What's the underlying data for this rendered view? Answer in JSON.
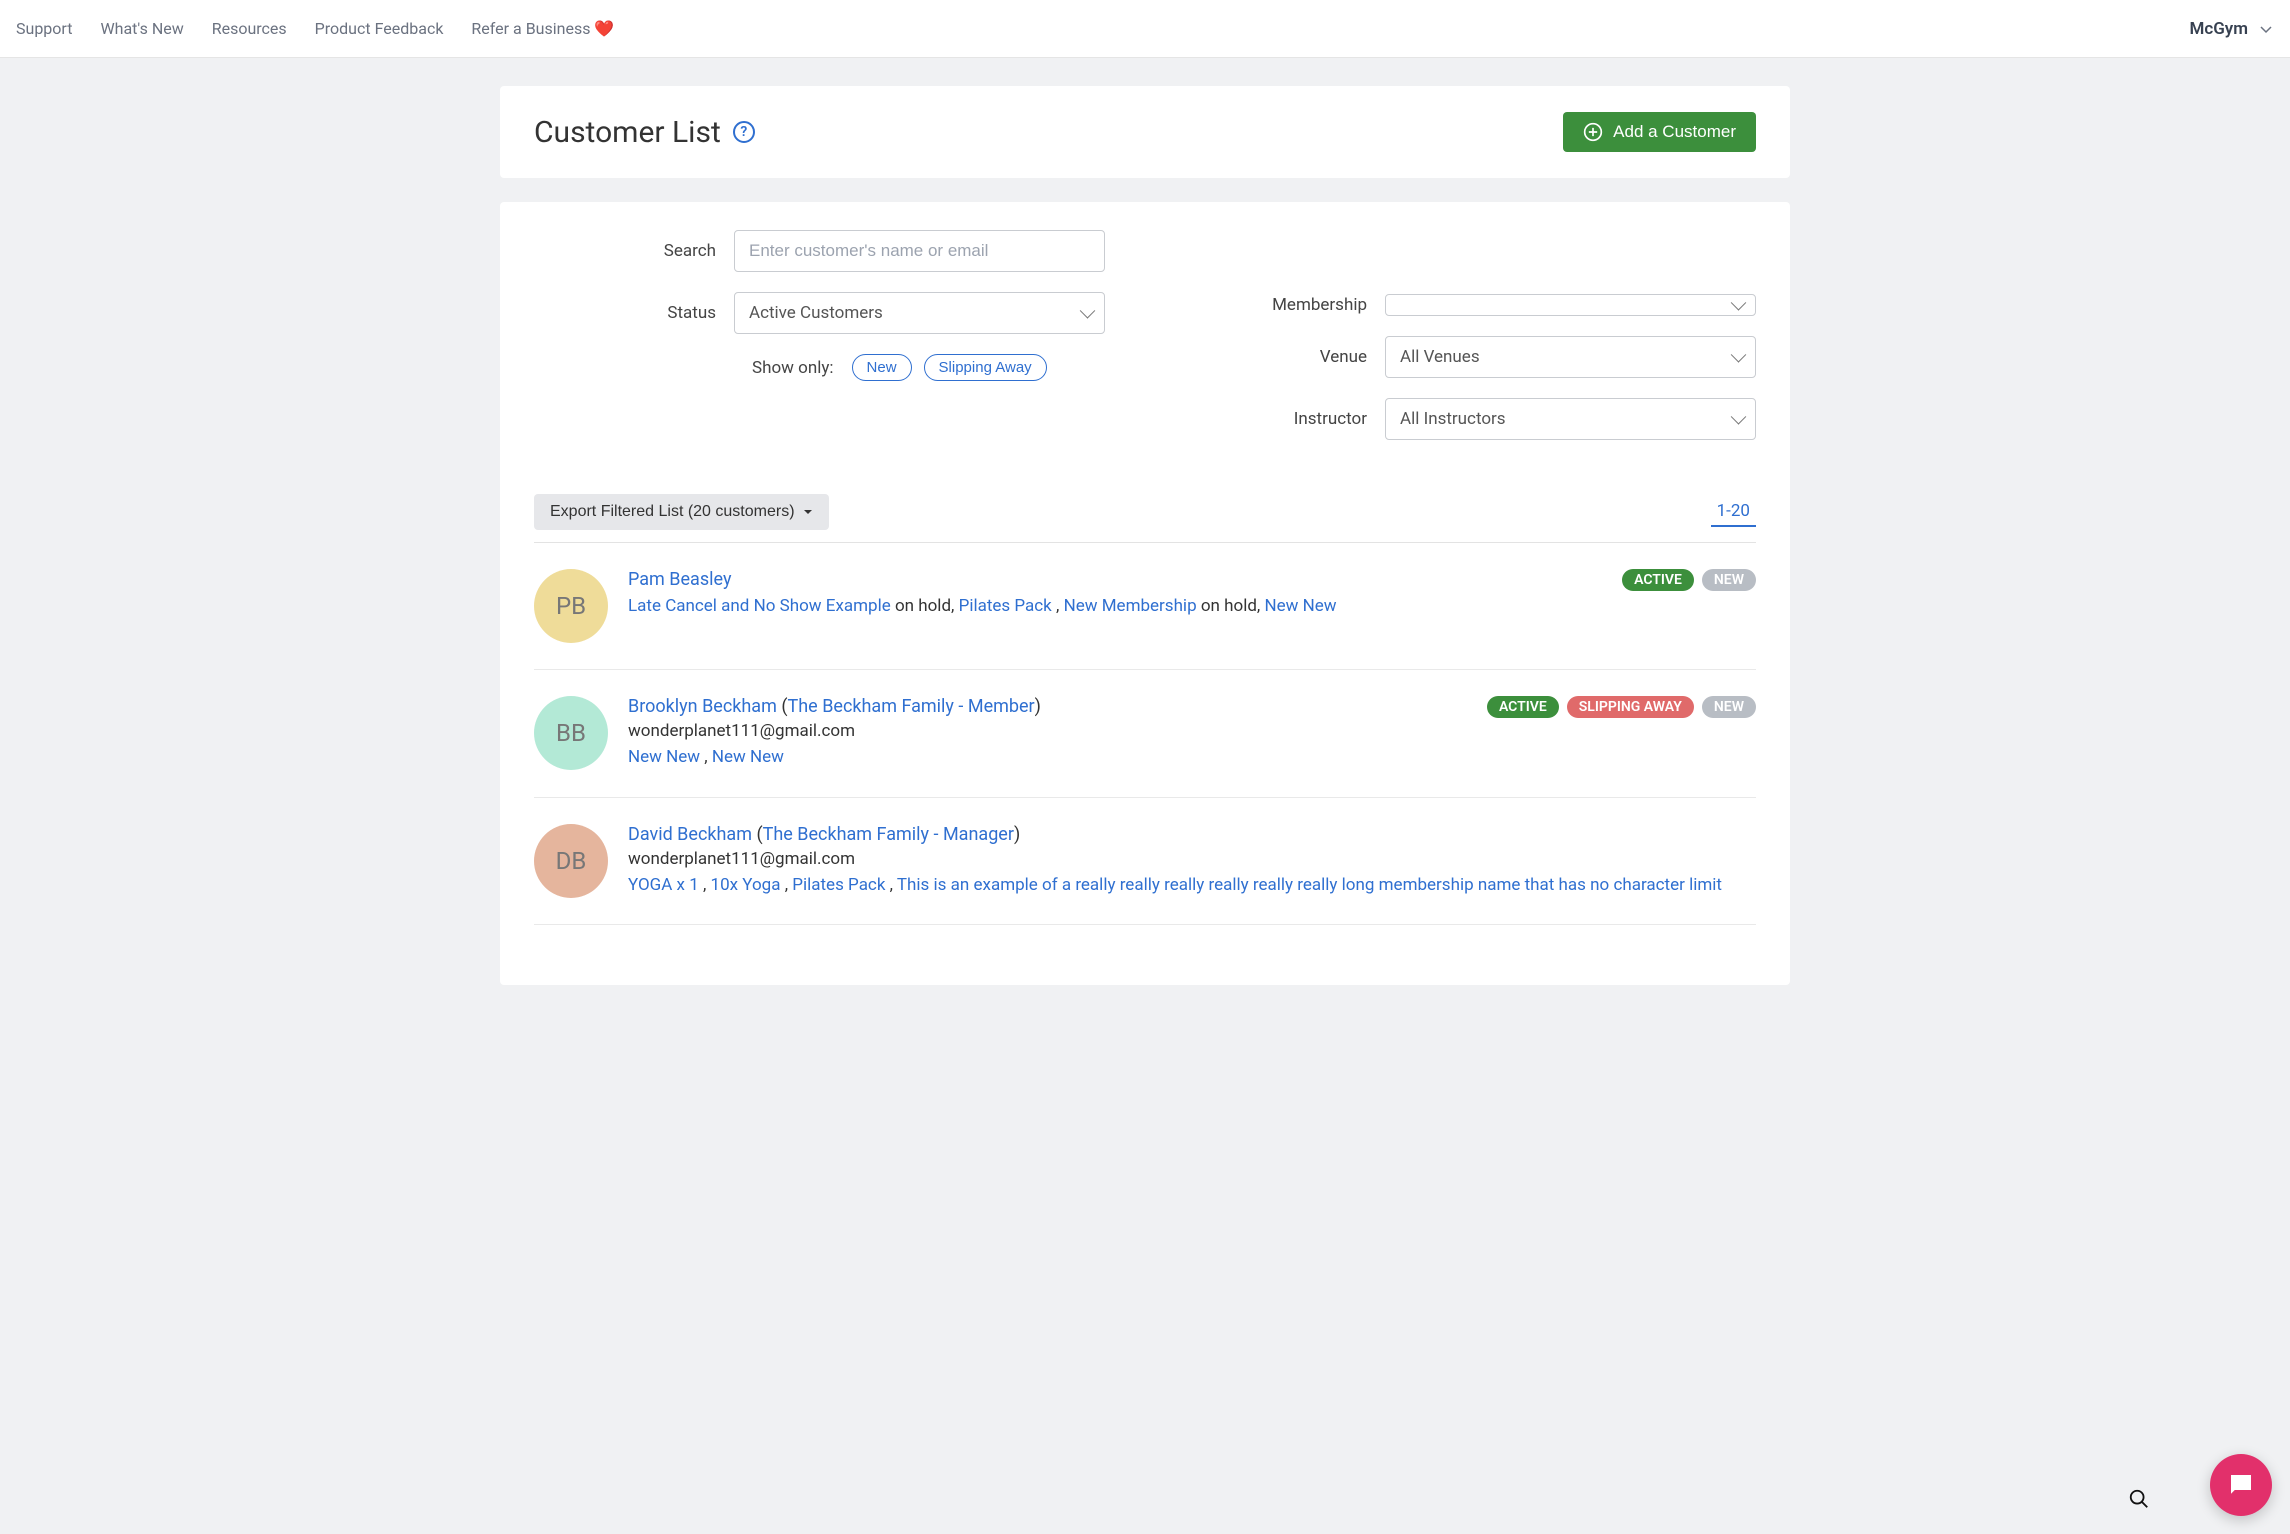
{
  "topnav": {
    "links": [
      "Support",
      "What's New",
      "Resources",
      "Product Feedback",
      "Refer a Business ❤️"
    ],
    "account": "McGym"
  },
  "header": {
    "title": "Customer List",
    "add_label": "Add a Customer"
  },
  "filters": {
    "search_label": "Search",
    "search_placeholder": "Enter customer's name or email",
    "status_label": "Status",
    "status_value": "Active Customers",
    "showonly_label": "Show only:",
    "showonly_chips": [
      "New",
      "Slipping Away"
    ],
    "membership_label": "Membership",
    "membership_value": "",
    "venue_label": "Venue",
    "venue_value": "All Venues",
    "instructor_label": "Instructor",
    "instructor_value": "All Instructors"
  },
  "toolbar": {
    "export_label": "Export Filtered List (20 customers)",
    "pager": "1-20"
  },
  "customers": [
    {
      "initials": "PB",
      "avatar_color": "#efdc99",
      "name": "Pam Beasley",
      "family": "",
      "email": "",
      "memberships": [
        {
          "text": "Late Cancel and No Show Example",
          "link": true
        },
        {
          "text": " on hold, ",
          "link": false
        },
        {
          "text": "Pilates Pack ",
          "link": true
        },
        {
          "text": ", ",
          "link": false
        },
        {
          "text": "New Membership",
          "link": true
        },
        {
          "text": " on hold, ",
          "link": false
        },
        {
          "text": "New New",
          "link": true
        }
      ],
      "badges": [
        "ACTIVE",
        "NEW"
      ]
    },
    {
      "initials": "BB",
      "avatar_color": "#b3e9d6",
      "name": "Brooklyn Beckham",
      "family": "The Beckham Family - Member",
      "email": "wonderplanet111@gmail.com",
      "memberships": [
        {
          "text": "New New ",
          "link": true
        },
        {
          "text": ", ",
          "link": false
        },
        {
          "text": "New New",
          "link": true
        }
      ],
      "badges": [
        "ACTIVE",
        "SLIPPING AWAY",
        "NEW"
      ]
    },
    {
      "initials": "DB",
      "avatar_color": "#e5b59d",
      "name": "David Beckham",
      "family": "The Beckham Family - Manager",
      "email": "wonderplanet111@gmail.com",
      "memberships": [
        {
          "text": "YOGA x 1 ",
          "link": true
        },
        {
          "text": ", ",
          "link": false
        },
        {
          "text": "10x Yoga ",
          "link": true
        },
        {
          "text": ", ",
          "link": false
        },
        {
          "text": "Pilates Pack ",
          "link": true
        },
        {
          "text": ", ",
          "link": false
        },
        {
          "text": "This is an example of a really really really really really really long membership name that has no character limit",
          "link": true
        }
      ],
      "badges": []
    }
  ]
}
